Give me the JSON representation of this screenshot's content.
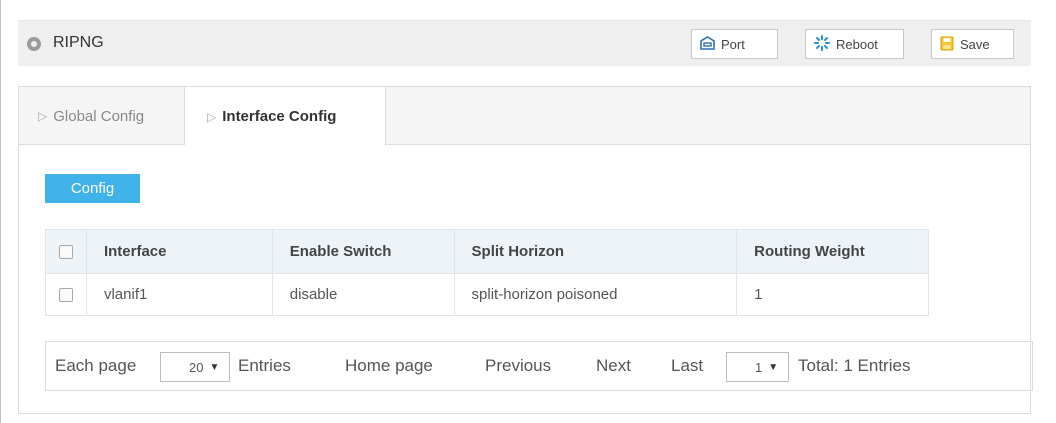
{
  "title": "RIPNG",
  "toolbar": {
    "port_label": "Port",
    "reboot_label": "Reboot",
    "save_label": "Save"
  },
  "tabs": [
    {
      "label": "Global Config",
      "active": false
    },
    {
      "label": "Interface Config",
      "active": true
    }
  ],
  "config_button": "Config",
  "table": {
    "headers": [
      "Interface",
      "Enable Switch",
      "Split Horizon",
      "Routing Weight"
    ],
    "rows": [
      {
        "interface": "vlanif1",
        "enable_switch": "disable",
        "split_horizon": "split-horizon poisoned",
        "routing_weight": "1"
      }
    ]
  },
  "pagination": {
    "each_page_label": "Each page",
    "page_size": "20",
    "entries_label": "Entries",
    "home_label": "Home page",
    "previous_label": "Previous",
    "next_label": "Next",
    "last_label": "Last",
    "current_page": "1",
    "total_label": "Total: 1 Entries"
  },
  "colors": {
    "accent": "#3fb2ea",
    "header_bg": "#eef3f8",
    "title_bar_bg": "#efefef"
  }
}
